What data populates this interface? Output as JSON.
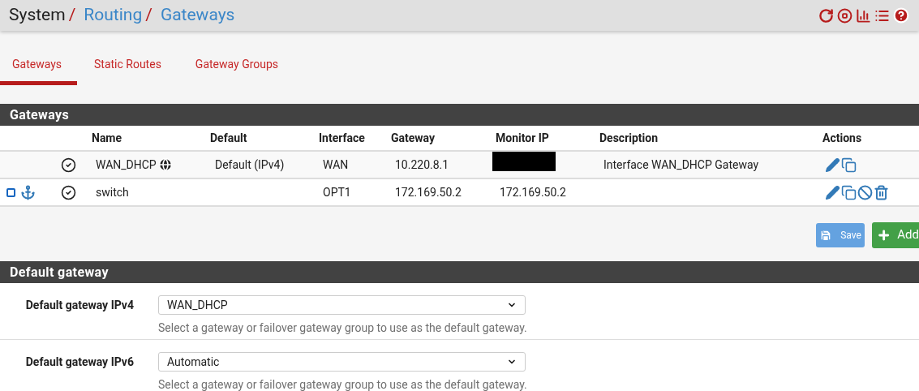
{
  "breadcrumb": [
    {
      "label": "System",
      "link": false,
      "separator": "/"
    },
    {
      "label": "Routing",
      "link": true,
      "separator": "/"
    },
    {
      "label": "Gateways",
      "link": true
    }
  ],
  "tabs": [
    {
      "label": "Gateways",
      "selected": true
    },
    {
      "label": "Static Routes",
      "selected": false
    },
    {
      "label": "Gateway Groups",
      "selected": false
    }
  ],
  "gateways_panel": {
    "title": "Gateways",
    "columns": [
      "Name",
      "Default",
      "Interface",
      "Gateway",
      "Monitor IP",
      "Description",
      "Actions"
    ],
    "rows": [
      {
        "name": "WAN_DHCP",
        "is_default": true,
        "default": "Default (IPv4)",
        "interface": "WAN",
        "gateway": "10.220.8.1",
        "monitor_ip_redacted": true,
        "description": "Interface WAN_DHCP Gateway",
        "actions": [
          {
            "kind": "edit"
          },
          {
            "kind": "copy"
          }
        ]
      },
      {
        "checked": false,
        "name": "switch",
        "is_default": false,
        "interface": "OPT1",
        "gateway": "172.169.50.2",
        "monitor_ip_redacted": false,
        "monitor_ip": "172.169.50.2",
        "actions": [
          {
            "kind": "edit"
          },
          {
            "kind": "copy"
          },
          {
            "kind": "disable"
          },
          {
            "kind": "delete"
          }
        ]
      }
    ],
    "buttons": [
      {
        "kind": "save",
        "label": "Save"
      },
      {
        "kind": "add",
        "label": "Add"
      }
    ]
  },
  "default_gateway_panel": {
    "title": "Default gateway",
    "fields": [
      {
        "label": "Default gateway IPv4",
        "value": "WAN_DHCP",
        "help": "Select a gateway or failover gateway group to use as the default gateway."
      },
      {
        "label": "Default gateway IPv6",
        "value": "Automatic",
        "help": "Select a gateway or failover gateway group to use as the default gateway."
      }
    ]
  }
}
